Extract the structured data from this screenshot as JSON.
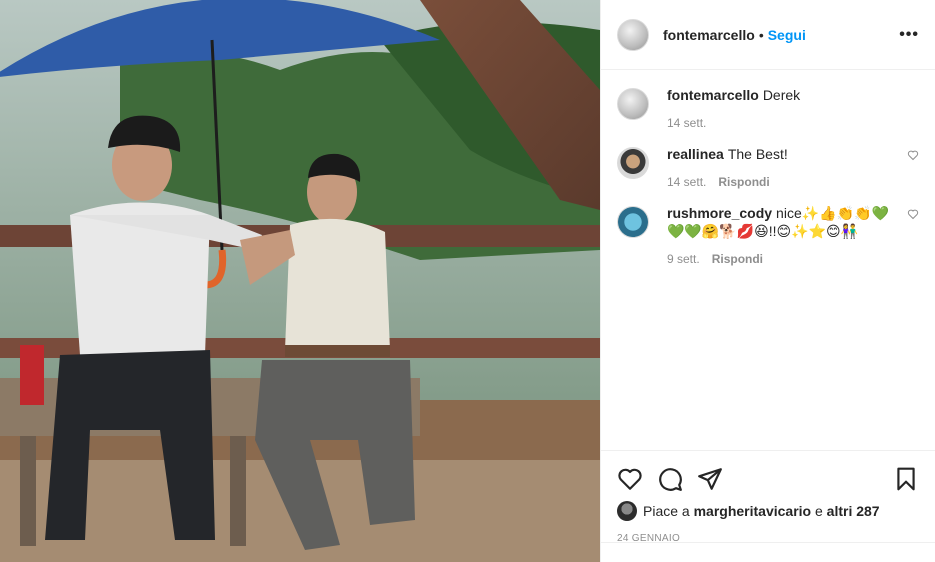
{
  "post": {
    "author": "fontemarcello",
    "separator": "•",
    "follow_label": "Segui",
    "more_label": "•••"
  },
  "caption": {
    "user": "fontemarcello",
    "text": "Derek",
    "time": "14 sett."
  },
  "comments": [
    {
      "user": "reallinea",
      "text": "The Best!",
      "time": "14 sett.",
      "reply_label": "Rispondi"
    },
    {
      "user": "rushmore_cody",
      "text": "nice✨👍👏👏💚💚💚🤗🐕💋😆!!😊✨⭐😊👫",
      "time": "9 sett.",
      "reply_label": "Rispondi"
    }
  ],
  "actions": {
    "likes_prefix": "Piace a",
    "liked_by": "margheritavicario",
    "likes_joiner": "e",
    "likes_rest": "altri 287",
    "date": "24 GENNAIO"
  },
  "icons": {
    "like": "heart-icon",
    "comment": "comment-icon",
    "share": "paper-plane-icon",
    "save": "bookmark-icon",
    "more": "ellipsis-icon"
  },
  "colors": {
    "link": "#0095f6",
    "text": "#262626",
    "muted": "#8e8e8e",
    "border": "#efefef"
  }
}
